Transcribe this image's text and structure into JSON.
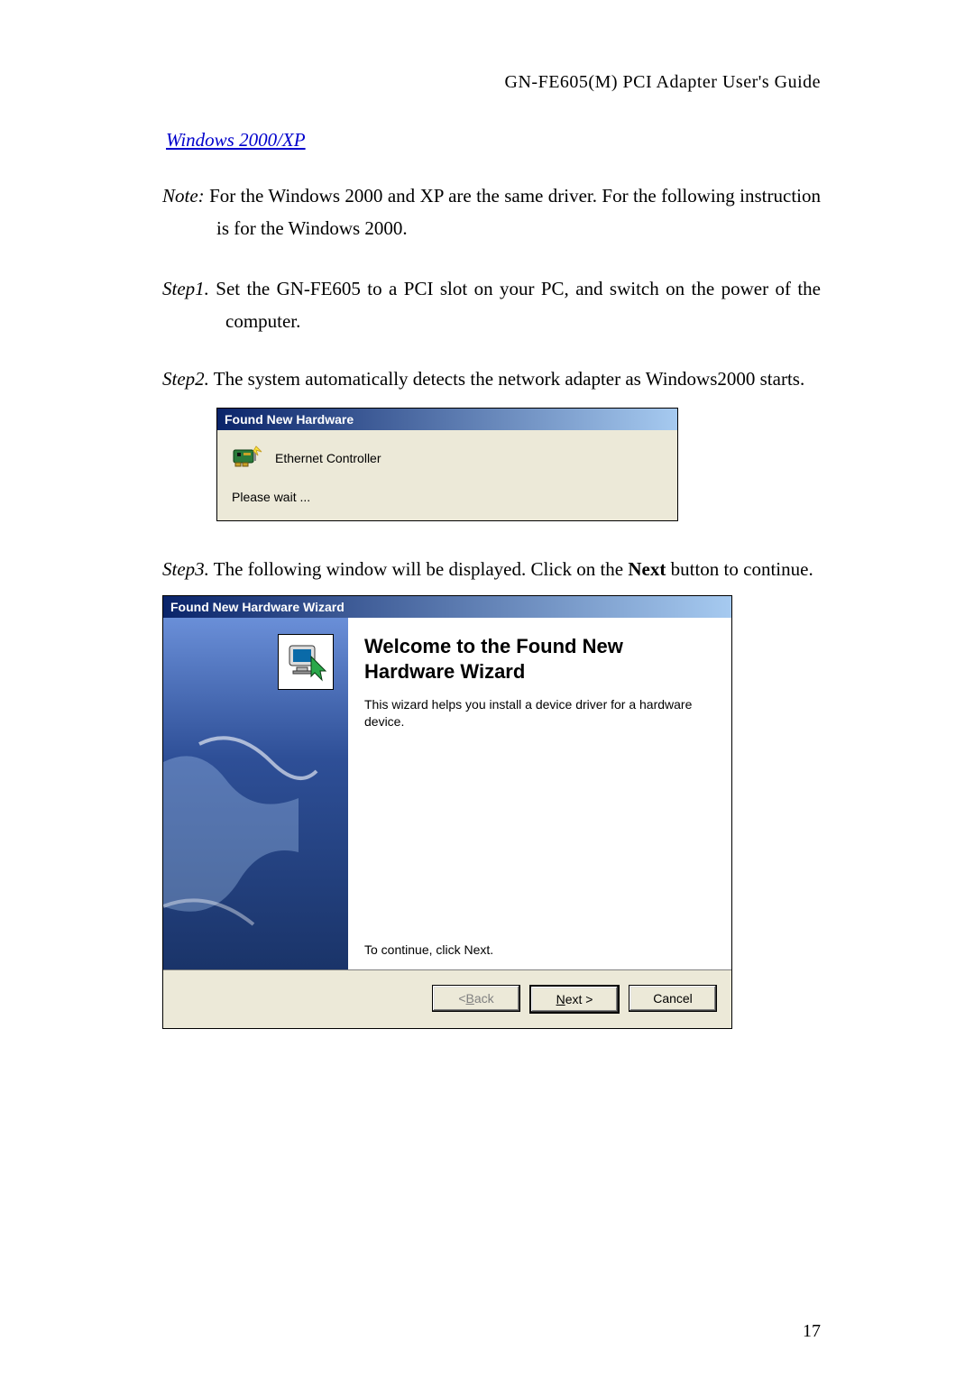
{
  "header": "GN-FE605(M) PCI Adapter User's Guide",
  "section_title": "Windows 2000/XP",
  "note_label": "Note:",
  "note_text": " For the Windows 2000 and XP are the same driver. For the following instruction is for the Windows 2000.",
  "step1_label": "Step1.",
  "step1_text": " Set the GN-FE605 to a PCI slot on your PC, and switch on the power of the computer.",
  "step2_label": "Step2.",
  "step2_text": " The system automatically detects the network adapter as Windows2000 starts.",
  "step3_label": "Step3.",
  "step3_text_a": " The following window will be displayed. Click on the ",
  "step3_text_bold": "Next",
  "step3_text_b": " button to continue.",
  "dlg1": {
    "title": "Found New Hardware",
    "device": "Ethernet Controller",
    "wait": "Please wait ..."
  },
  "dlg2": {
    "title": "Found New Hardware Wizard",
    "heading": "Welcome to the Found New Hardware Wizard",
    "body": "This wizard helps you install a device driver for a hardware device.",
    "continue": "To continue, click Next.",
    "back_u": "B",
    "back_rest": "ack",
    "back_prefix": "< ",
    "next_u": "N",
    "next_rest": "ext >",
    "cancel": "Cancel"
  },
  "page_number": "17"
}
